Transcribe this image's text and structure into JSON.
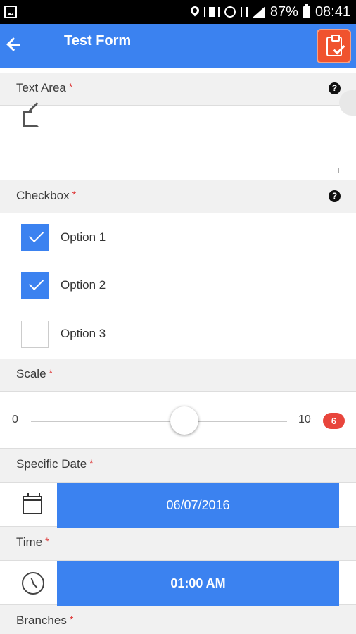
{
  "status_bar": {
    "battery": "87%",
    "time": "08:41"
  },
  "appbar": {
    "title": "Test Form"
  },
  "fields": {
    "text_area": {
      "label": "Text Area",
      "required": "*",
      "help": "?"
    },
    "checkbox": {
      "label": "Checkbox",
      "required": "*",
      "help": "?",
      "options": [
        {
          "label": "Option 1",
          "checked": true
        },
        {
          "label": "Option 2",
          "checked": true
        },
        {
          "label": "Option 3",
          "checked": false
        }
      ]
    },
    "scale": {
      "label": "Scale",
      "required": "*",
      "min": "0",
      "max": "10",
      "value": "6"
    },
    "specific_date": {
      "label": "Specific Date",
      "required": "*",
      "value": "06/07/2016"
    },
    "time": {
      "label": "Time",
      "required": "*",
      "value": "01:00 AM"
    },
    "branches": {
      "label": "Branches",
      "required": "*"
    }
  },
  "colors": {
    "primary": "#3b82f0",
    "required": "#dd3333",
    "badge": "#e8453c",
    "app_icon": "#f0532e"
  }
}
